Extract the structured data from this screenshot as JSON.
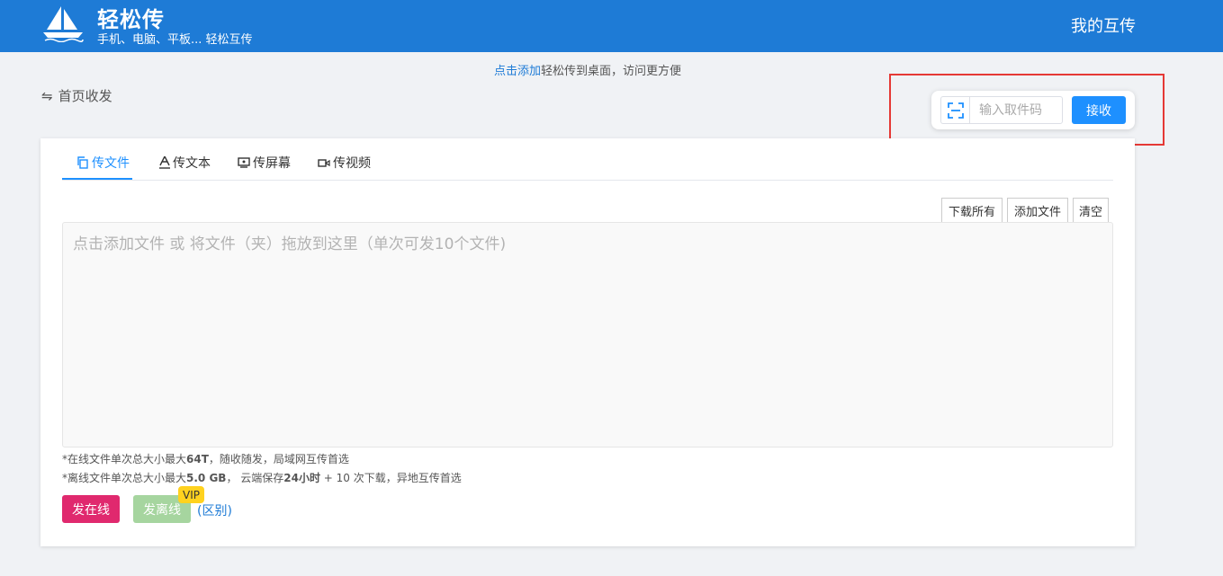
{
  "header": {
    "logo_icon": "sailboat-icon",
    "title": "轻松传",
    "subtitle": "手机、电脑、平板... 轻松互传",
    "my_transfer": "我的互传",
    "bg_color": "#1e7bd6"
  },
  "tip": {
    "link": "点击添加",
    "text": "轻松传到桌面，访问更方便"
  },
  "breadcrumb": {
    "icon": "swap-icon",
    "label": "首页收发"
  },
  "receive": {
    "scan_icon": "scan-icon",
    "placeholder": "输入取件码",
    "button": "接收"
  },
  "tabs": [
    {
      "label": "传文件",
      "icon": "copy-icon",
      "active": true
    },
    {
      "label": "传文本",
      "icon": "text-icon",
      "active": false
    },
    {
      "label": "传屏幕",
      "icon": "screen-icon",
      "active": false
    },
    {
      "label": "传视频",
      "icon": "video-icon",
      "active": false
    }
  ],
  "toolbar": {
    "download_all": "下载所有",
    "add_file": "添加文件",
    "clear": "清空"
  },
  "dropzone": {
    "text": "点击添加文件 或 将文件（夹）拖放到这里（单次可发10个文件)"
  },
  "notes": {
    "online_prefix": "*在线文件单次总大小最大",
    "online_size": "64T",
    "online_suffix": "，随收随发，局域网互传首选",
    "offline_prefix": "*离线文件单次总大小最大",
    "offline_size": "5.0 GB",
    "offline_mid": "， 云端保存",
    "offline_hours": "24小时",
    "offline_suffix": " + 10 次下载，异地互传首选"
  },
  "actions": {
    "send_online": "发在线",
    "send_offline": "发离线",
    "vip": "VIP",
    "difference": "(区别)"
  },
  "colors": {
    "primary": "#1e90ff",
    "highlight": "#e53935",
    "send_online": "#e0296e",
    "send_offline": "#a6d59f",
    "vip": "#ffd21f"
  }
}
